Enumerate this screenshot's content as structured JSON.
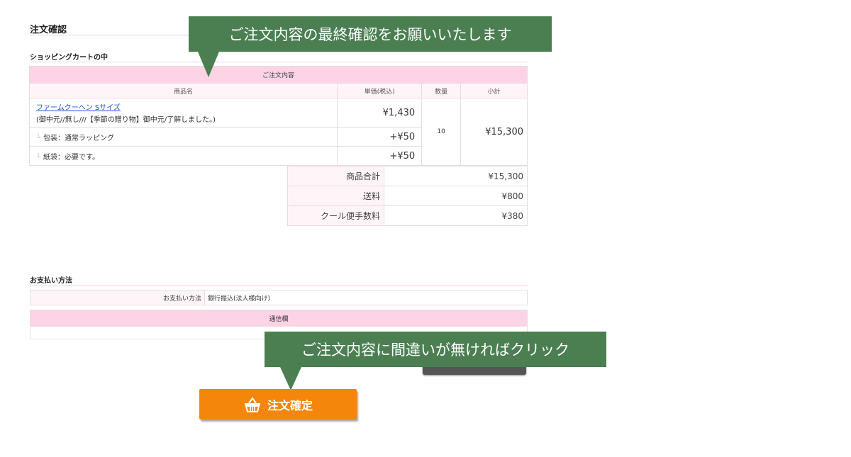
{
  "page": {
    "title": "注文確認",
    "cart_section_title": "ショッピングカートの中",
    "payment_section_title": "お支払い方法"
  },
  "cart": {
    "header": "ご注文内容",
    "columns": [
      "商品名",
      "単価(税込)",
      "数量",
      "小計"
    ],
    "product": {
      "name": "ファームクーヘン Sサイズ",
      "options_text": "(御中元//無し///【季節の贈り物】御中元/了解しました。)",
      "unit_price": "¥1,430",
      "quantity": "10",
      "subtotal": "¥15,300"
    },
    "options": [
      {
        "label": "包装：通常ラッピング",
        "price": "+¥50"
      },
      {
        "label": "紙袋：必要です。",
        "price": "+¥50"
      }
    ]
  },
  "totals": [
    {
      "label": "商品合計",
      "value": "¥15,300"
    },
    {
      "label": "送料",
      "value": "¥800"
    },
    {
      "label": "クール便手数料",
      "value": "¥380"
    }
  ],
  "payment": {
    "label": "お支払い方法",
    "value": "銀行振込(法人様向け)"
  },
  "memo": {
    "header": "通信欄",
    "value": ""
  },
  "callouts": {
    "top": "ご注文内容の最終確認をお願いいたします",
    "bottom": "ご注文内容に間違いが無ければクリック"
  },
  "buttons": {
    "confirm_label": "注文確定",
    "confirm_icon": "basket-icon"
  },
  "colors": {
    "accent_pink": "#fdd3e6",
    "callout_green": "#4b7f52",
    "confirm_orange": "#f5860c",
    "link_blue": "#1b4fd0"
  }
}
